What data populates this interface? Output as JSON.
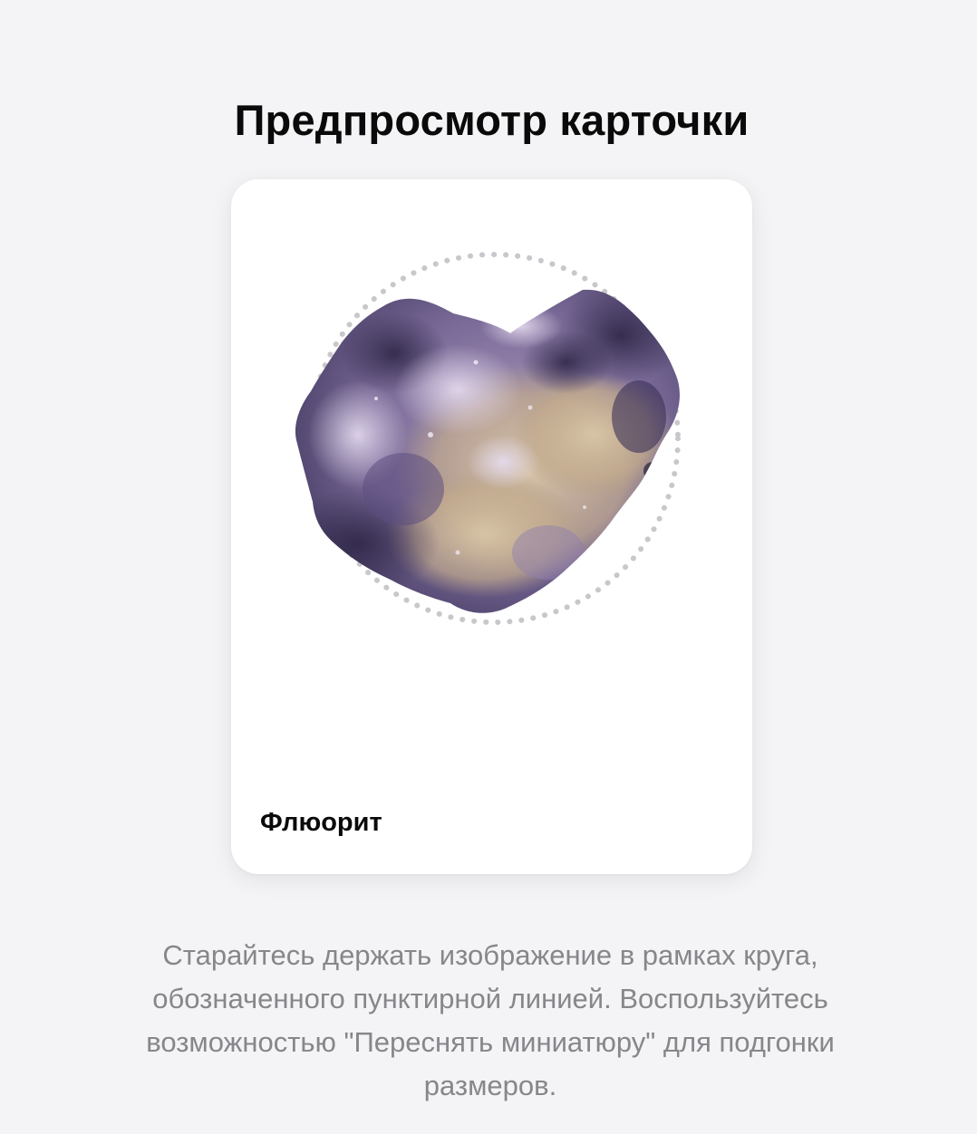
{
  "header": {
    "title": "Предпросмотр карточки"
  },
  "card": {
    "label": "Флюорит",
    "image_alt": "Флюорит",
    "guide_icon": "dotted-circle-guide"
  },
  "hint": {
    "text": "Старайтесь держать изображение в рамках круга, обозначенного пунктирной линией. Воспользуйтесь возможностью \"Переснять миниатюру\" для подгонки размеров."
  },
  "colors": {
    "background": "#f4f4f6",
    "card": "#ffffff",
    "title": "#0a0a0a",
    "hint": "#86868b",
    "guide": "#c8c8cc",
    "stone_dark": "#4f4570",
    "stone_light": "#c9b59a"
  }
}
